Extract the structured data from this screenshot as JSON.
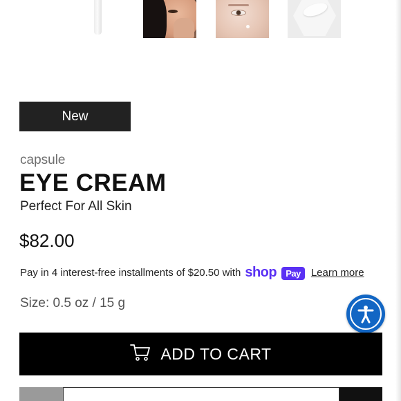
{
  "gallery": {
    "thumbnails": [
      {
        "alt": "product-tube"
      },
      {
        "alt": "model-applying-cream"
      },
      {
        "alt": "eye-closeup"
      },
      {
        "alt": "cream-texture"
      }
    ]
  },
  "product": {
    "badge": "New",
    "brand": "capsule",
    "name": "EYE CREAM",
    "subtitle": "Perfect For All Skin",
    "price": "$82.00",
    "size": "Size: 0.5 oz / 15 g"
  },
  "installments": {
    "text": "Pay in 4 interest-free installments of $20.50 with",
    "shop_word": "shop",
    "pay_word": "Pay",
    "learn_more": "Learn more"
  },
  "cart": {
    "button_label": "ADD TO CART",
    "icon": "cart-icon"
  },
  "accessibility": {
    "icon": "accessibility-icon"
  },
  "colors": {
    "badge_bg": "#222222",
    "shop_pay_purple": "#5a31f4",
    "accessibility_blue": "#1266c4",
    "cart_button_bg": "#000000"
  }
}
